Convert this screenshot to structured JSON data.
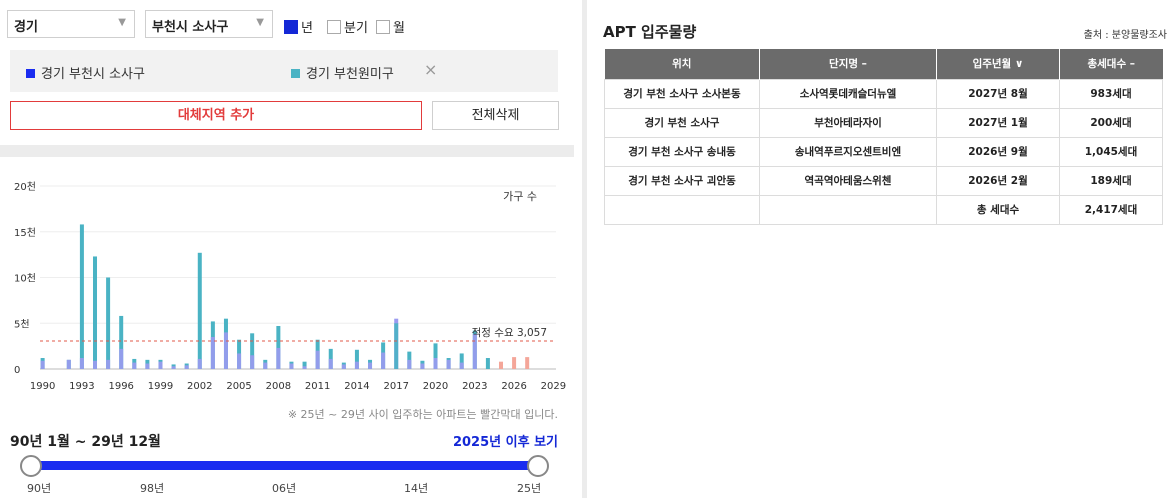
{
  "filters": {
    "province": "경기",
    "district": "부천시 소사구",
    "period_options": [
      {
        "label": "년",
        "checked": true
      },
      {
        "label": "분기",
        "checked": false
      },
      {
        "label": "월",
        "checked": false
      }
    ]
  },
  "regions": [
    {
      "label": "경기 부천시 소사구",
      "color": "#1a2cf0"
    },
    {
      "label": "경기 부천원미구",
      "color": "#4ab3c4"
    }
  ],
  "close_icon": "×",
  "buttons": {
    "add": "대체지역 추가",
    "delete_all": "전체삭제"
  },
  "chart_data": {
    "type": "bar",
    "legend_text": "가구 수",
    "y_ticks": [
      "0",
      "5천",
      "10천",
      "15천",
      "20천"
    ],
    "ylim": [
      0,
      20000
    ],
    "x_tick_labels": [
      "1990",
      "1993",
      "1996",
      "1999",
      "2002",
      "2005",
      "2008",
      "2011",
      "2014",
      "2017",
      "2020",
      "2023",
      "2026",
      "2029"
    ],
    "years": [
      1990,
      1991,
      1992,
      1993,
      1994,
      1995,
      1996,
      1997,
      1998,
      1999,
      2000,
      2001,
      2002,
      2003,
      2004,
      2005,
      2006,
      2007,
      2008,
      2009,
      2010,
      2011,
      2012,
      2013,
      2014,
      2015,
      2016,
      2017,
      2018,
      2019,
      2020,
      2021,
      2022,
      2023,
      2024,
      2025,
      2026,
      2027
    ],
    "series": [
      {
        "name": "경기 부천시 소사구",
        "color": "#9a9af0",
        "values": [
          900,
          0,
          1000,
          1200,
          900,
          1000,
          2200,
          700,
          600,
          800,
          300,
          400,
          1100,
          3500,
          4000,
          1700,
          1500,
          700,
          2300,
          600,
          300,
          2000,
          1100,
          500,
          800,
          700,
          1800,
          5500,
          1000,
          600,
          1200,
          1000,
          700,
          3800,
          0,
          0,
          0,
          0
        ]
      },
      {
        "name": "경기 부천원미구",
        "color": "#4ab3c4",
        "values": [
          1200,
          0,
          1000,
          15800,
          12300,
          10000,
          5800,
          1100,
          1000,
          1000,
          500,
          600,
          12700,
          5200,
          5500,
          3200,
          3900,
          1000,
          4700,
          800,
          800,
          3200,
          2200,
          700,
          2100,
          1000,
          2900,
          5000,
          1900,
          900,
          2800,
          1200,
          1700,
          4200,
          1200,
          0,
          0,
          0
        ]
      },
      {
        "name": "25년 ~ 29년",
        "color": "#f4a699",
        "values": [
          0,
          0,
          0,
          0,
          0,
          0,
          0,
          0,
          0,
          0,
          0,
          0,
          0,
          0,
          0,
          0,
          0,
          0,
          0,
          0,
          0,
          0,
          0,
          0,
          0,
          0,
          0,
          0,
          0,
          0,
          0,
          0,
          0,
          0,
          0,
          800,
          1300,
          1300
        ]
      }
    ],
    "reference_line": {
      "label": "적정 수요 3,057",
      "value": 3057,
      "color": "#e05a4a"
    }
  },
  "note": "※ 25년 ~ 29년 사이 입주하는 아파트는 빨간막대 입니다.",
  "range_label": "90년 1월 ~ 29년 12월",
  "after_link": "2025년 이후 보기",
  "slider_ticks": [
    "90년",
    "98년",
    "06년",
    "14년",
    "25년"
  ],
  "apt": {
    "title": "APT 입주물량",
    "source": "출처 : 분양물량조사",
    "headers": [
      "위치",
      "단지명 –",
      "입주년월 ∨",
      "총세대수 –"
    ],
    "rows": [
      [
        "경기 부천 소사구 소사본동",
        "소사역롯데캐슬더뉴엘",
        "2027년 8월",
        "983세대"
      ],
      [
        "경기 부천 소사구",
        "부천아테라자이",
        "2027년 1월",
        "200세대"
      ],
      [
        "경기 부천 소사구 송내동",
        "송내역푸르지오센트비엔",
        "2026년 9월",
        "1,045세대"
      ],
      [
        "경기 부천 소사구 괴안동",
        "역곡역아테움스위첸",
        "2026년 2월",
        "189세대"
      ]
    ],
    "total_label": "총 세대수",
    "total_value": "2,417세대"
  }
}
